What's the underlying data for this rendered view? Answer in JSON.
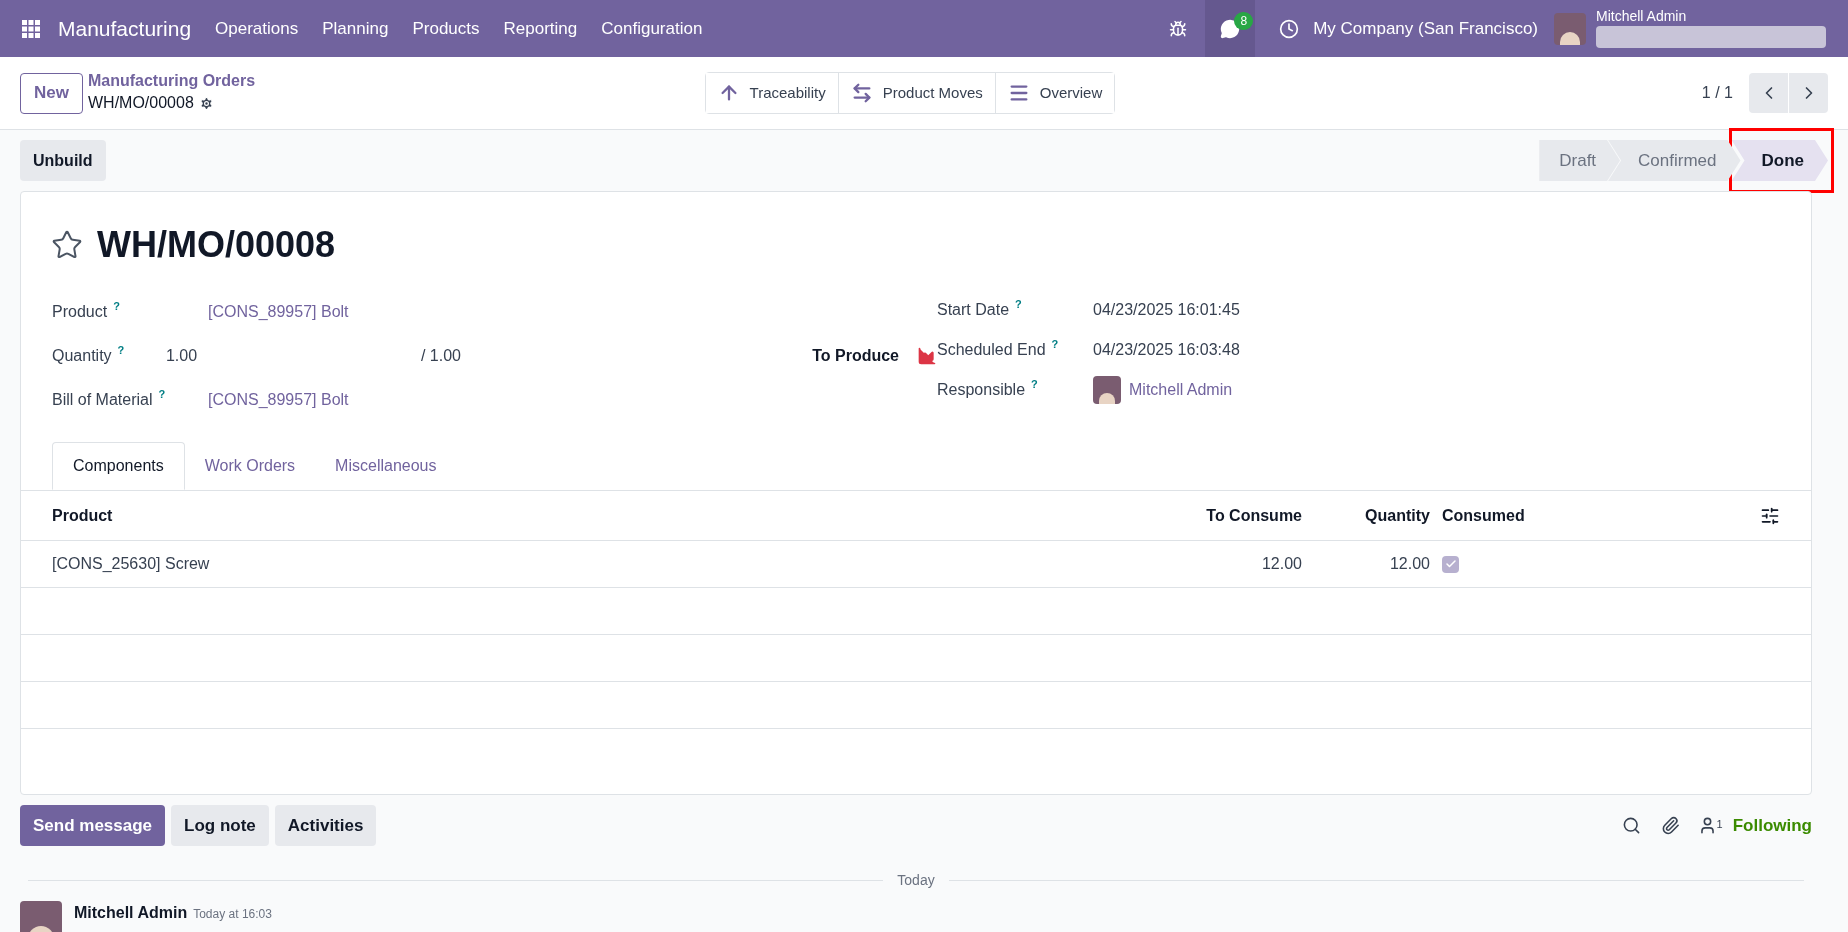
{
  "navbar": {
    "app": "Manufacturing",
    "menu": [
      "Operations",
      "Planning",
      "Products",
      "Reporting",
      "Configuration"
    ],
    "messages_count": "8",
    "company": "My Company (San Francisco)",
    "user": "Mitchell Admin"
  },
  "control_panel": {
    "new_button": "New",
    "breadcrumb": "Manufacturing Orders",
    "record": "WH/MO/00008",
    "pager": "1 / 1",
    "smart_buttons": [
      {
        "label": "Traceability",
        "kind": "up"
      },
      {
        "label": "Product Moves",
        "kind": "exchange"
      },
      {
        "label": "Overview",
        "kind": "list"
      }
    ]
  },
  "action_buttons": [
    "Unbuild"
  ],
  "stages": [
    {
      "label": "Draft",
      "selected": false,
      "highlighted": false
    },
    {
      "label": "Confirmed",
      "selected": false,
      "highlighted": false
    },
    {
      "label": "Done",
      "selected": true,
      "highlighted": true
    }
  ],
  "form": {
    "title": "WH/MO/00008",
    "starred": false,
    "left_fields": [
      {
        "label": "Product",
        "help": "?",
        "value": "[CONS_89957] Bolt",
        "kind": "link"
      },
      {
        "label": "Quantity",
        "help": "?",
        "value": "1.00",
        "extra": "/ 1.00",
        "kind": "quantity"
      },
      {
        "label": "Bill of Material",
        "help": "?",
        "value": "[CONS_89957] Bolt",
        "kind": "link"
      }
    ],
    "to_produce": "To Produce",
    "right_fields": [
      {
        "label": "Start Date",
        "help": "?",
        "value": "04/23/2025 16:01:45",
        "kind": "text"
      },
      {
        "label": "Scheduled End",
        "help": "?",
        "value": "04/23/2025 16:03:48",
        "kind": "text"
      },
      {
        "label": "Responsible",
        "help": "?",
        "value": "Mitchell Admin",
        "kind": "user"
      }
    ],
    "tabs": [
      {
        "label": "Components",
        "selected": true
      },
      {
        "label": "Work Orders",
        "selected": false
      },
      {
        "label": "Miscellaneous",
        "selected": false
      }
    ],
    "table": {
      "columns": [
        "Product",
        "To Consume",
        "Quantity",
        "Consumed"
      ],
      "rows": [
        {
          "product": "[CONS_25630] Screw",
          "to_consume": "12.00",
          "quantity": "12.00",
          "consumed": true
        }
      ]
    }
  },
  "chatter": {
    "buttons": [
      {
        "label": "Send message",
        "selected": true
      },
      {
        "label": "Log note",
        "selected": false
      },
      {
        "label": "Activities",
        "selected": false
      }
    ],
    "followers": "1",
    "following": "Following",
    "divider": "Today",
    "message": {
      "author": "Mitchell Admin",
      "time": "Today at 16:03"
    }
  }
}
